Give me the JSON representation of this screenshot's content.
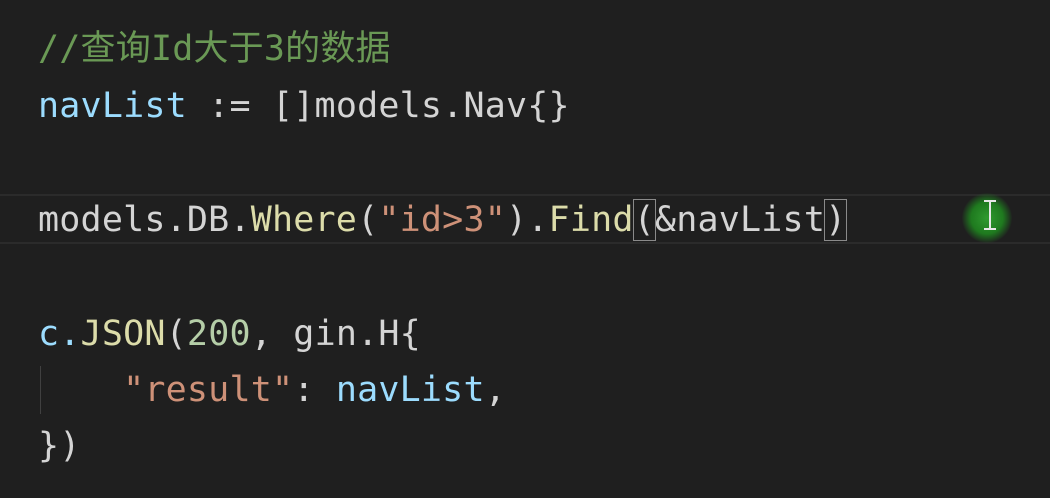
{
  "editor": {
    "line1": {
      "comment": "//查询Id大于3的数据"
    },
    "line2": {
      "var": "navList",
      "assign": " := ",
      "slice": "[]",
      "type": "models.Nav",
      "braces": "{}"
    },
    "line4": {
      "pkg": "models.DB.",
      "method": "Where",
      "open": "(",
      "arg": "\"id>3\"",
      "close": ").",
      "method2": "Find",
      "open2": "(",
      "arg2": "&navList",
      "close2": ")"
    },
    "line6": {
      "obj": "c.",
      "method": "JSON",
      "open": "(",
      "num": "200",
      "sep": ", ",
      "pkg": "gin.H",
      "brace": "{"
    },
    "line7": {
      "indent": "    ",
      "key": "\"result\"",
      "colon": ": ",
      "value": "navList",
      "comma": ","
    },
    "line8": {
      "close": "})"
    }
  },
  "colors": {
    "background": "#1f1f1f",
    "comment": "#6a9955",
    "variable": "#9cdcfe",
    "function": "#dcdcaa",
    "string": "#ce9178",
    "number": "#b5cea8",
    "cursor_highlight": "#2f9a2f"
  },
  "icons": {
    "cursor": "text-ibeam-cursor-icon"
  }
}
